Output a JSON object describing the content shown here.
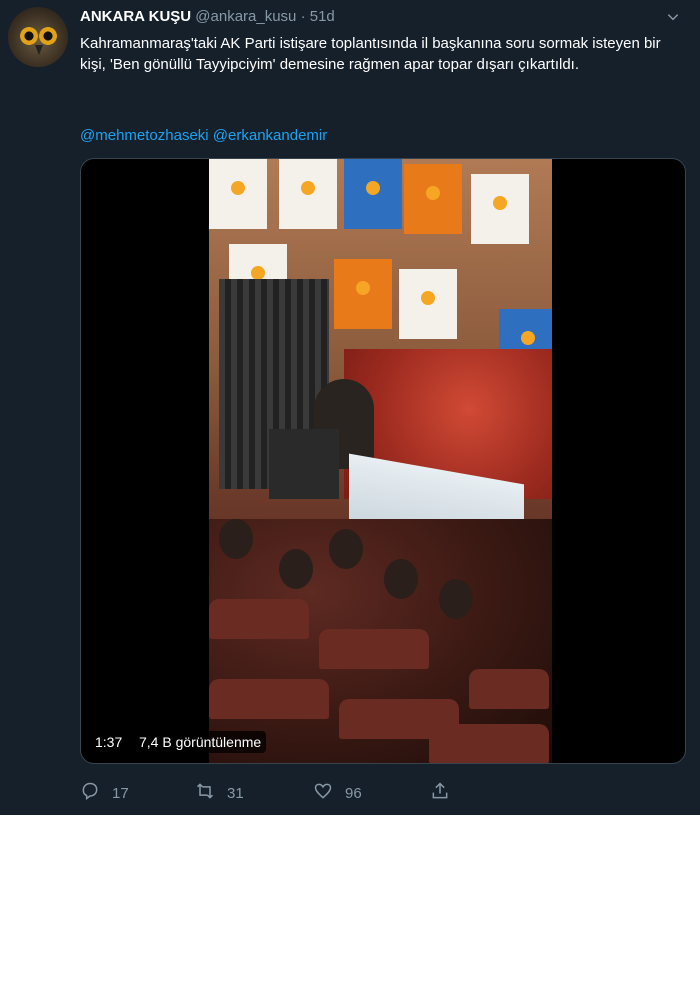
{
  "tweet": {
    "author_name": "ANKARA KUŞU",
    "author_handle": "@ankara_kusu",
    "separator": "·",
    "timestamp": "51d",
    "text": "Kahramanmaraş'taki AK Parti istişare toplantısında il başkanına soru sormak isteyen bir kişi, 'Ben gönüllü Tayyipciyim' demesine rağmen apar topar dışarı çıkartıldı.",
    "mentions": [
      "@mehmetozhaseki",
      "@erkankandemir"
    ]
  },
  "video": {
    "duration": "1:37",
    "views": "7,4 B görüntülenme"
  },
  "actions": {
    "reply_count": "17",
    "retweet_count": "31",
    "like_count": "96"
  },
  "icons": {
    "avatar": "owl-avatar",
    "caret": "chevron-down-icon",
    "reply": "reply-icon",
    "retweet": "retweet-icon",
    "like": "heart-icon",
    "share": "share-icon"
  },
  "colors": {
    "background": "#15202b",
    "text_primary": "#ffffff",
    "text_secondary": "#8899a6",
    "link": "#1da1f2",
    "border": "#38444d"
  }
}
